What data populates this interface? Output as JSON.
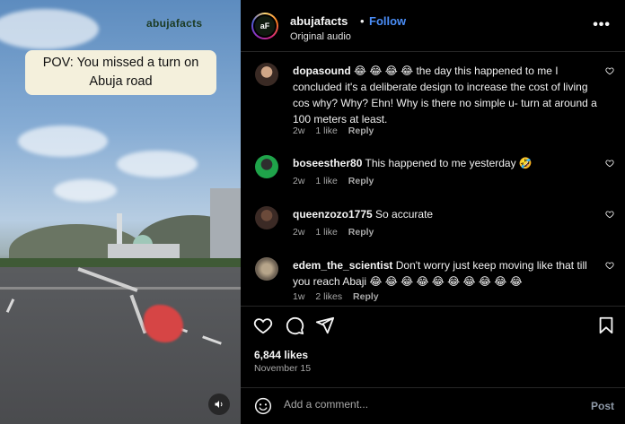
{
  "video": {
    "watermark": "abujafacts",
    "caption": "POV: You missed a turn on Abuja road"
  },
  "post": {
    "username": "abujafacts",
    "avatar_text": "aF",
    "dot": "•",
    "follow_label": "Follow",
    "audio_label": "Original audio",
    "more_label": "•••",
    "likes": "6,844 likes",
    "date": "November 15"
  },
  "comments": [
    {
      "username": "dopasound",
      "emojis_lead": "😂 😂 😂 😂",
      "text": "the day this happened to me I concluded it's a deliberate design to increase the cost of living cos why? Why? Ehn! Why is there no simple u- turn at around a 100 meters at least.",
      "age": "2w",
      "likes": "1 like",
      "reply": "Reply"
    },
    {
      "username": "boseesther80",
      "text": "This happened to me yesterday 🤣",
      "age": "2w",
      "likes": "1 like",
      "reply": "Reply"
    },
    {
      "username": "queenzozo1775",
      "text": "So accurate",
      "age": "2w",
      "likes": "1 like",
      "reply": "Reply"
    },
    {
      "username": "edem_the_scientist",
      "text": "Don't worry just keep moving like that till you reach Abaji 😂 😂 😂 😂 😂 😂 😂 😂 😂 😂",
      "age": "1w",
      "likes": "2 likes",
      "reply": "Reply"
    }
  ],
  "composer": {
    "placeholder": "Add a comment...",
    "post_label": "Post"
  },
  "colors": {
    "accent": "#4a8df6",
    "background": "#000000",
    "muted": "#a8a8a8"
  },
  "icons": [
    "heart-icon",
    "comment-icon",
    "share-icon",
    "bookmark-icon",
    "emoji-icon",
    "speaker-icon",
    "more-icon"
  ]
}
